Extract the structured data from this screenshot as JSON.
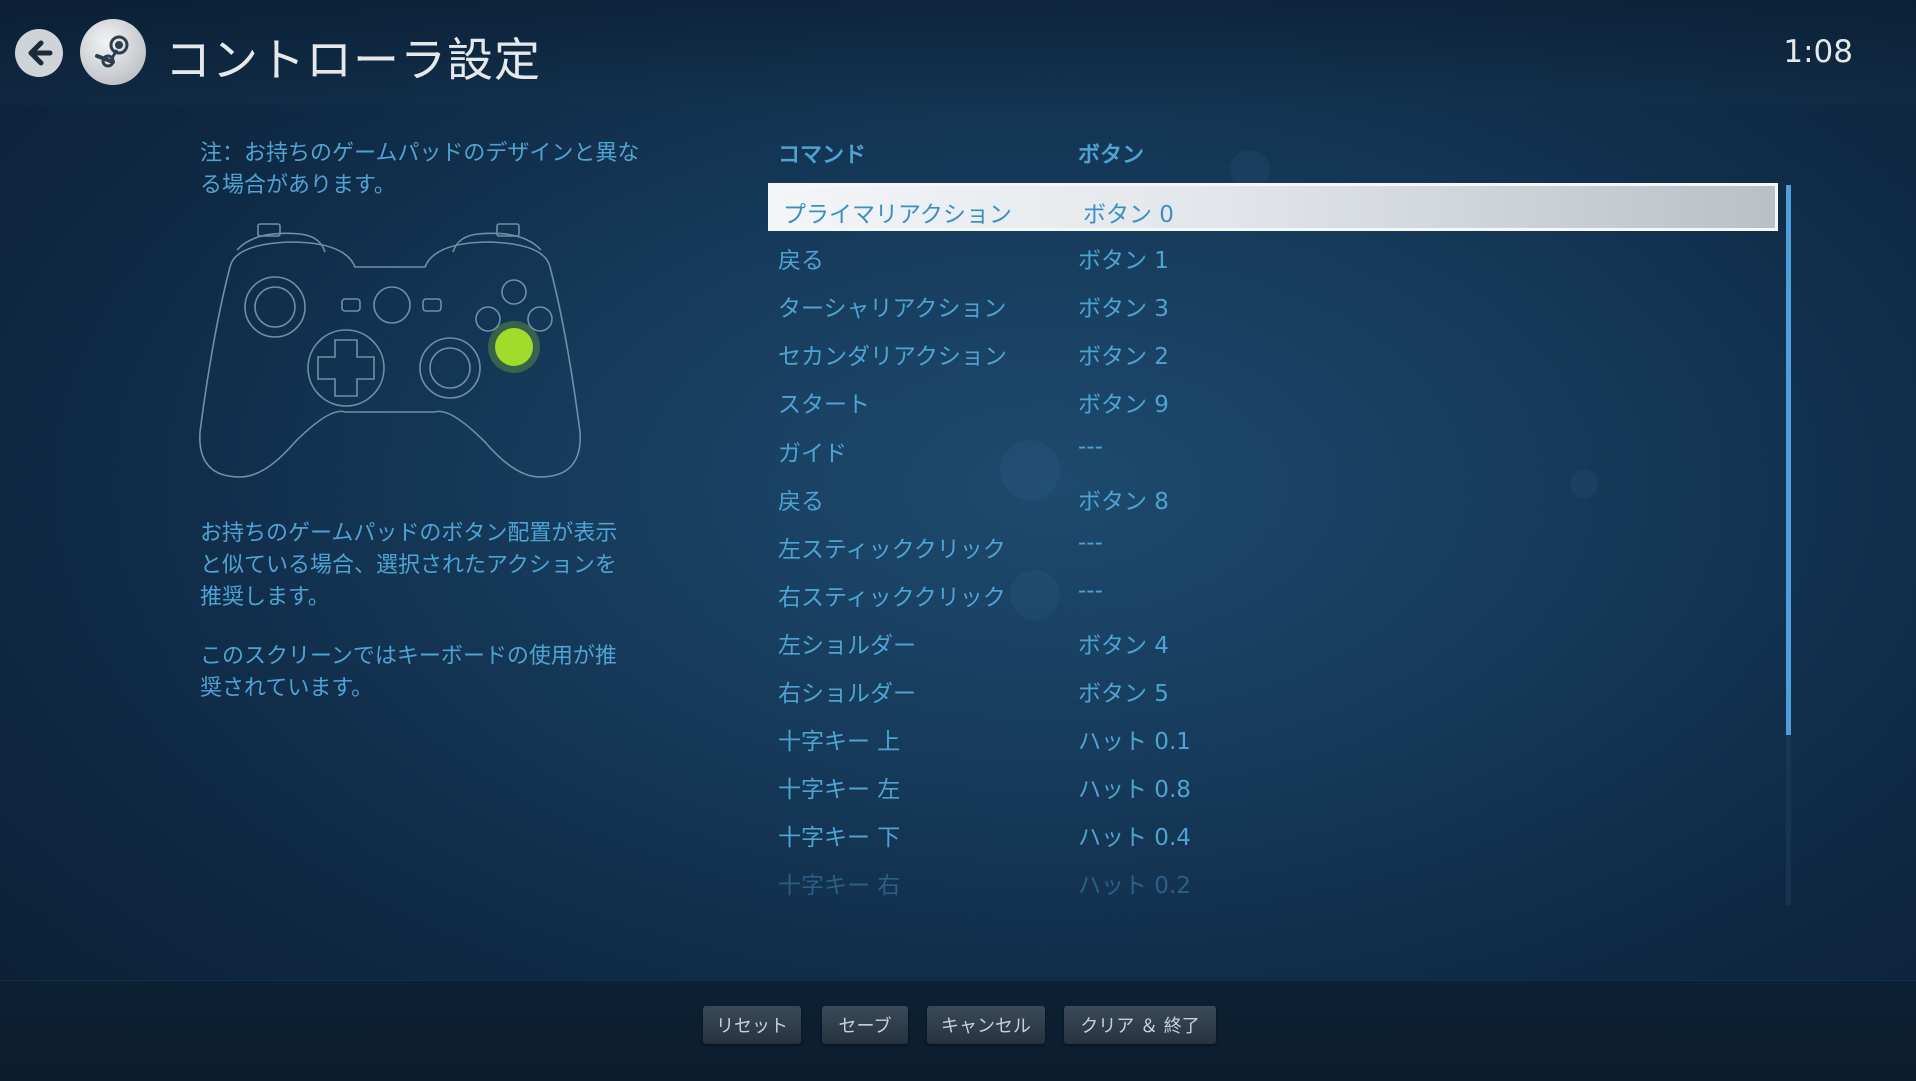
{
  "header": {
    "title": "コントローラ設定",
    "time": "1:08"
  },
  "left_panel": {
    "note": "注：お持ちのゲームパッドのデザインと異なる場合があります。",
    "description": "お持ちのゲームパッドのボタン配置が表示と似ている場合、選択されたアクションを推奨します。",
    "keyboard_note": "このスクリーンではキーボードの使用が推奨されています。"
  },
  "table": {
    "headers": {
      "command": "コマンド",
      "button": "ボタン"
    },
    "rows": [
      {
        "command": "プライマリアクション",
        "button": "ボタン 0"
      },
      {
        "command": "戻る",
        "button": "ボタン 1"
      },
      {
        "command": "ターシャリアクション",
        "button": "ボタン 3"
      },
      {
        "command": "セカンダリアクション",
        "button": "ボタン 2"
      },
      {
        "command": "スタート",
        "button": "ボタン 9"
      },
      {
        "command": "ガイド",
        "button": "---"
      },
      {
        "command": "戻る",
        "button": "ボタン 8"
      },
      {
        "command": "左スティッククリック",
        "button": "---"
      },
      {
        "command": "右スティッククリック",
        "button": "---"
      },
      {
        "command": "左ショルダー",
        "button": "ボタン 4"
      },
      {
        "command": "右ショルダー",
        "button": "ボタン 5"
      },
      {
        "command": "十字キー 上",
        "button": "ハット 0.1"
      },
      {
        "command": "十字キー 左",
        "button": "ハット 0.8"
      },
      {
        "command": "十字キー 下",
        "button": "ハット 0.4"
      },
      {
        "command": "十字キー 右",
        "button": "ハット 0.2"
      }
    ],
    "selected_index": 0
  },
  "footer": {
    "reset": "リセット",
    "save": "セーブ",
    "cancel": "キャンセル",
    "clear_exit": "クリア ＆ 終了"
  },
  "colors": {
    "accent": "#4fa3d3",
    "highlight_button": "#a6e22a",
    "background": "#163a5a"
  }
}
